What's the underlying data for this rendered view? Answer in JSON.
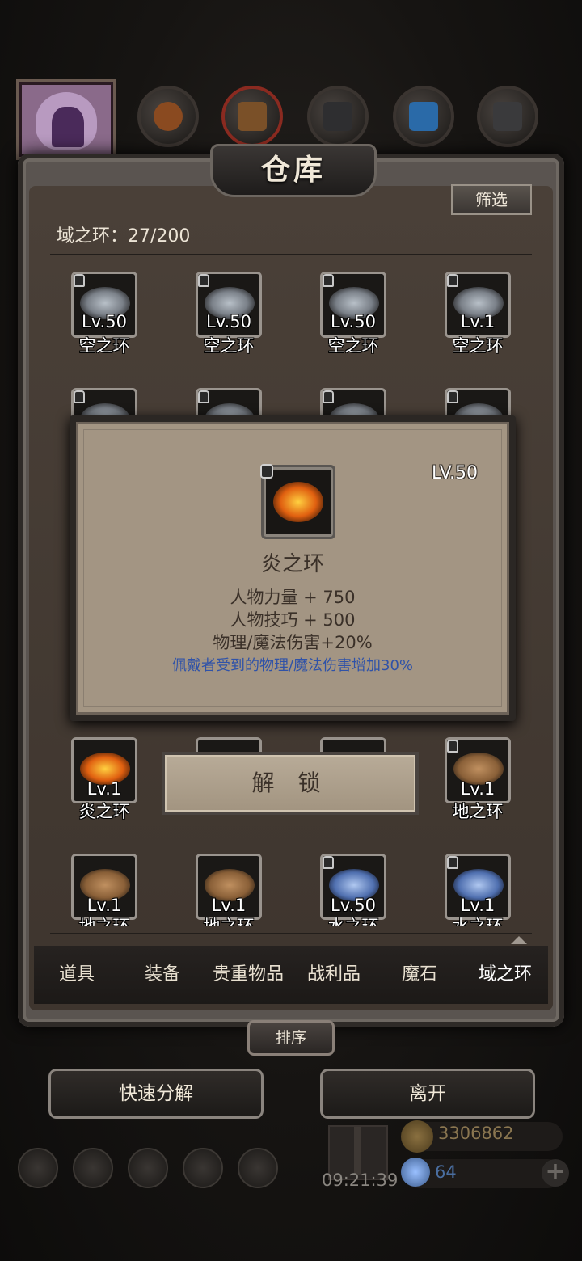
{
  "window": {
    "title": "仓库"
  },
  "filter_label": "筛选",
  "storage_count": "域之环：27/200",
  "items": [
    {
      "level": "Lv.50",
      "name": "空之环",
      "element": "sky",
      "locked": true
    },
    {
      "level": "Lv.50",
      "name": "空之环",
      "element": "sky",
      "locked": true
    },
    {
      "level": "Lv.50",
      "name": "空之环",
      "element": "sky",
      "locked": true
    },
    {
      "level": "Lv.1",
      "name": "空之环",
      "element": "sky",
      "locked": true
    },
    {
      "level": "Lv.1",
      "name": "炎之环",
      "element": "fire",
      "locked": false
    },
    {
      "level": "Lv.1",
      "name": "地之环",
      "element": "earth",
      "locked": true
    },
    {
      "level": "Lv.1",
      "name": "地之环",
      "element": "earth",
      "locked": false
    },
    {
      "level": "Lv.1",
      "name": "地之环",
      "element": "earth",
      "locked": false
    },
    {
      "level": "Lv.50",
      "name": "水之环",
      "element": "water",
      "locked": true
    },
    {
      "level": "Lv.1",
      "name": "水之环",
      "element": "water",
      "locked": true
    }
  ],
  "popup": {
    "level": "LV.50",
    "name": "炎之环",
    "stats": [
      "人物力量 + 750",
      "人物技巧 + 500",
      "物理/魔法伤害+20%"
    ],
    "special": "佩戴者受到的物理/魔法伤害增加30%",
    "unlock_label": "解 锁"
  },
  "tabs": [
    "道具",
    "装备",
    "贵重物品",
    "战利品",
    "魔石",
    "域之环"
  ],
  "active_tab": "域之环",
  "sort_label": "排序",
  "actions": {
    "quick_decompose": "快速分解",
    "leave": "离开"
  },
  "hud": {
    "time": "09:21:39",
    "gold": "3306862",
    "gems": "64",
    "plus": "+"
  },
  "colors": {
    "popup_bg": "#a39583",
    "special_text": "#2f52a8",
    "frame": "#5a5450"
  }
}
